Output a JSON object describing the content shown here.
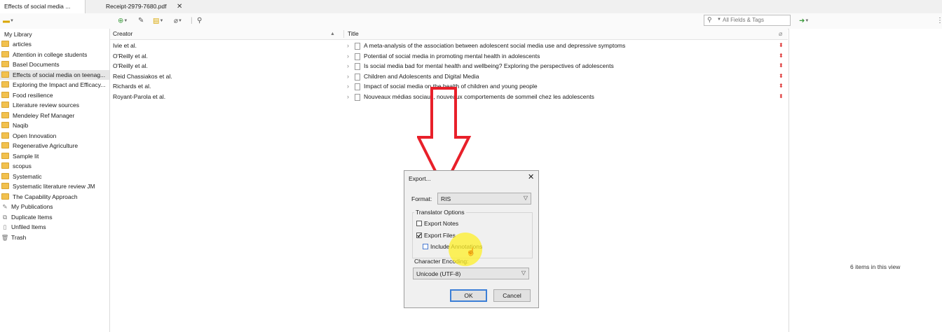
{
  "tabs": [
    {
      "label": "Effects of social media ...",
      "active": true
    },
    {
      "label": "Receipt-2979-7680.pdf",
      "active": false
    }
  ],
  "search": {
    "placeholder": "All Fields & Tags"
  },
  "library": {
    "root": "My Library",
    "collections": [
      "articles",
      "Attention in college students",
      "Basel Documents",
      "Effects of social media on teenag...",
      "Exploring the Impact and Efficacy...",
      "Food resilience",
      "Literature review sources",
      "Mendeley Ref Manager",
      "Naqib",
      "Open Innovation",
      "Regenerative Agriculture",
      "Sample lit",
      "scopus",
      "Systematic",
      "Systematic literature review JM",
      "The Capability Approach"
    ],
    "special": [
      "My Publications",
      "Duplicate Items",
      "Unfiled Items",
      "Trash"
    ]
  },
  "columns": {
    "creator": "Creator",
    "sort_indicator": "▲",
    "title": "Title"
  },
  "items": [
    {
      "creator": "Ivie et al.",
      "title": "A meta-analysis of the association between adolescent social media use and depressive symptoms"
    },
    {
      "creator": "O'Reilly et al.",
      "title": "Potential of social media in promoting mental health in adolescents"
    },
    {
      "creator": "O'Reilly et al.",
      "title": "Is social media bad for mental health and wellbeing? Exploring the perspectives of adolescents"
    },
    {
      "creator": "Reid Chassiakos et al.",
      "title": "Children and Adolescents and Digital Media"
    },
    {
      "creator": "Richards et al.",
      "title": "Impact of social media on the health of children and young people"
    },
    {
      "creator": "Royant-Parola et al.",
      "title": "Nouveaux médias sociaux, nouveaux comportements de sommeil chez les adolescents"
    }
  ],
  "item_count": "6 items in this view",
  "dialog": {
    "title": "Export...",
    "format_label": "Format:",
    "format_value": "RIS",
    "options_legend": "Translator Options",
    "export_notes": {
      "label": "Export Notes",
      "checked": false
    },
    "export_files": {
      "label": "Export Files",
      "checked": true
    },
    "include_annotations": {
      "label": "Include Annotations",
      "checked": false
    },
    "encoding_label": "Character Encoding:",
    "encoding_value": "Unicode (UTF-8)",
    "ok_label": "OK",
    "cancel_label": "Cancel"
  },
  "colors": {
    "arrow": "#e8202a",
    "highlight": "#fff028",
    "selection": "#e6e6e6",
    "ok_focus": "#3c7fd6"
  }
}
